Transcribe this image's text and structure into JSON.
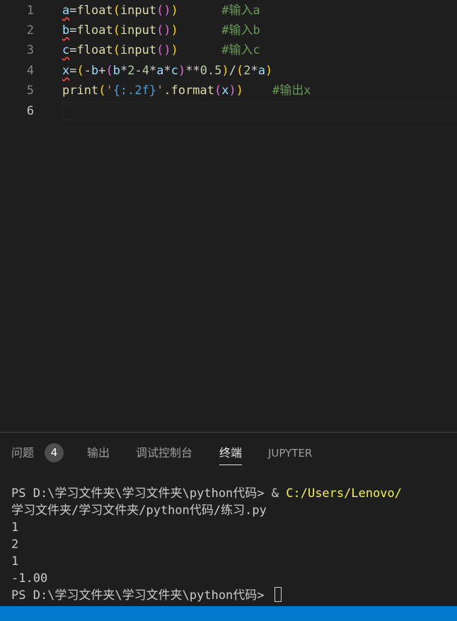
{
  "editor": {
    "lines": [
      {
        "num": "1",
        "var": "a",
        "rest_op": "=",
        "func": "float",
        "p_open": "(",
        "inner_func": "input",
        "pp": "()",
        "p_close": ")",
        "comment": "#输入a"
      },
      {
        "num": "2",
        "var": "b",
        "rest_op": "=",
        "func": "float",
        "p_open": "(",
        "inner_func": "input",
        "pp": "()",
        "p_close": ")",
        "comment": "#输入b"
      },
      {
        "num": "3",
        "var": "c",
        "rest_op": "=",
        "func": "float",
        "p_open": "(",
        "inner_func": "input",
        "pp": "()",
        "p_close": ")",
        "comment": "#输入c"
      },
      {
        "num": "4",
        "var": "x"
      },
      {
        "num": "5",
        "func": "print",
        "string": "'{:.2f}'",
        "method": ".format",
        "arg": "x",
        "comment": "#输出x"
      },
      {
        "num": "6"
      }
    ]
  },
  "panel": {
    "tabs": [
      {
        "label": "问题",
        "badge": "4"
      },
      {
        "label": "输出"
      },
      {
        "label": "调试控制台"
      },
      {
        "label": "终端",
        "active": true
      },
      {
        "label": "JUPYTER"
      }
    ],
    "terminal": {
      "prompt1": "PS D:\\学习文件夹\\学习文件夹\\python代码> ",
      "cmd_amp": "& ",
      "cmd_path": "C:/Users/Lenovo/",
      "line2": "学习文件夹/学习文件夹/python代码/练习.py",
      "outputs": [
        "1",
        "2",
        "1",
        "-1.00"
      ],
      "prompt2": "PS D:\\学习文件夹\\学习文件夹\\python代码> "
    }
  },
  "colors": {
    "editor_bg": "#1e1e1e",
    "statusbar": "#007acc",
    "comment": "#6a9955",
    "function": "#dcdcaa",
    "variable": "#9cdcfe"
  }
}
